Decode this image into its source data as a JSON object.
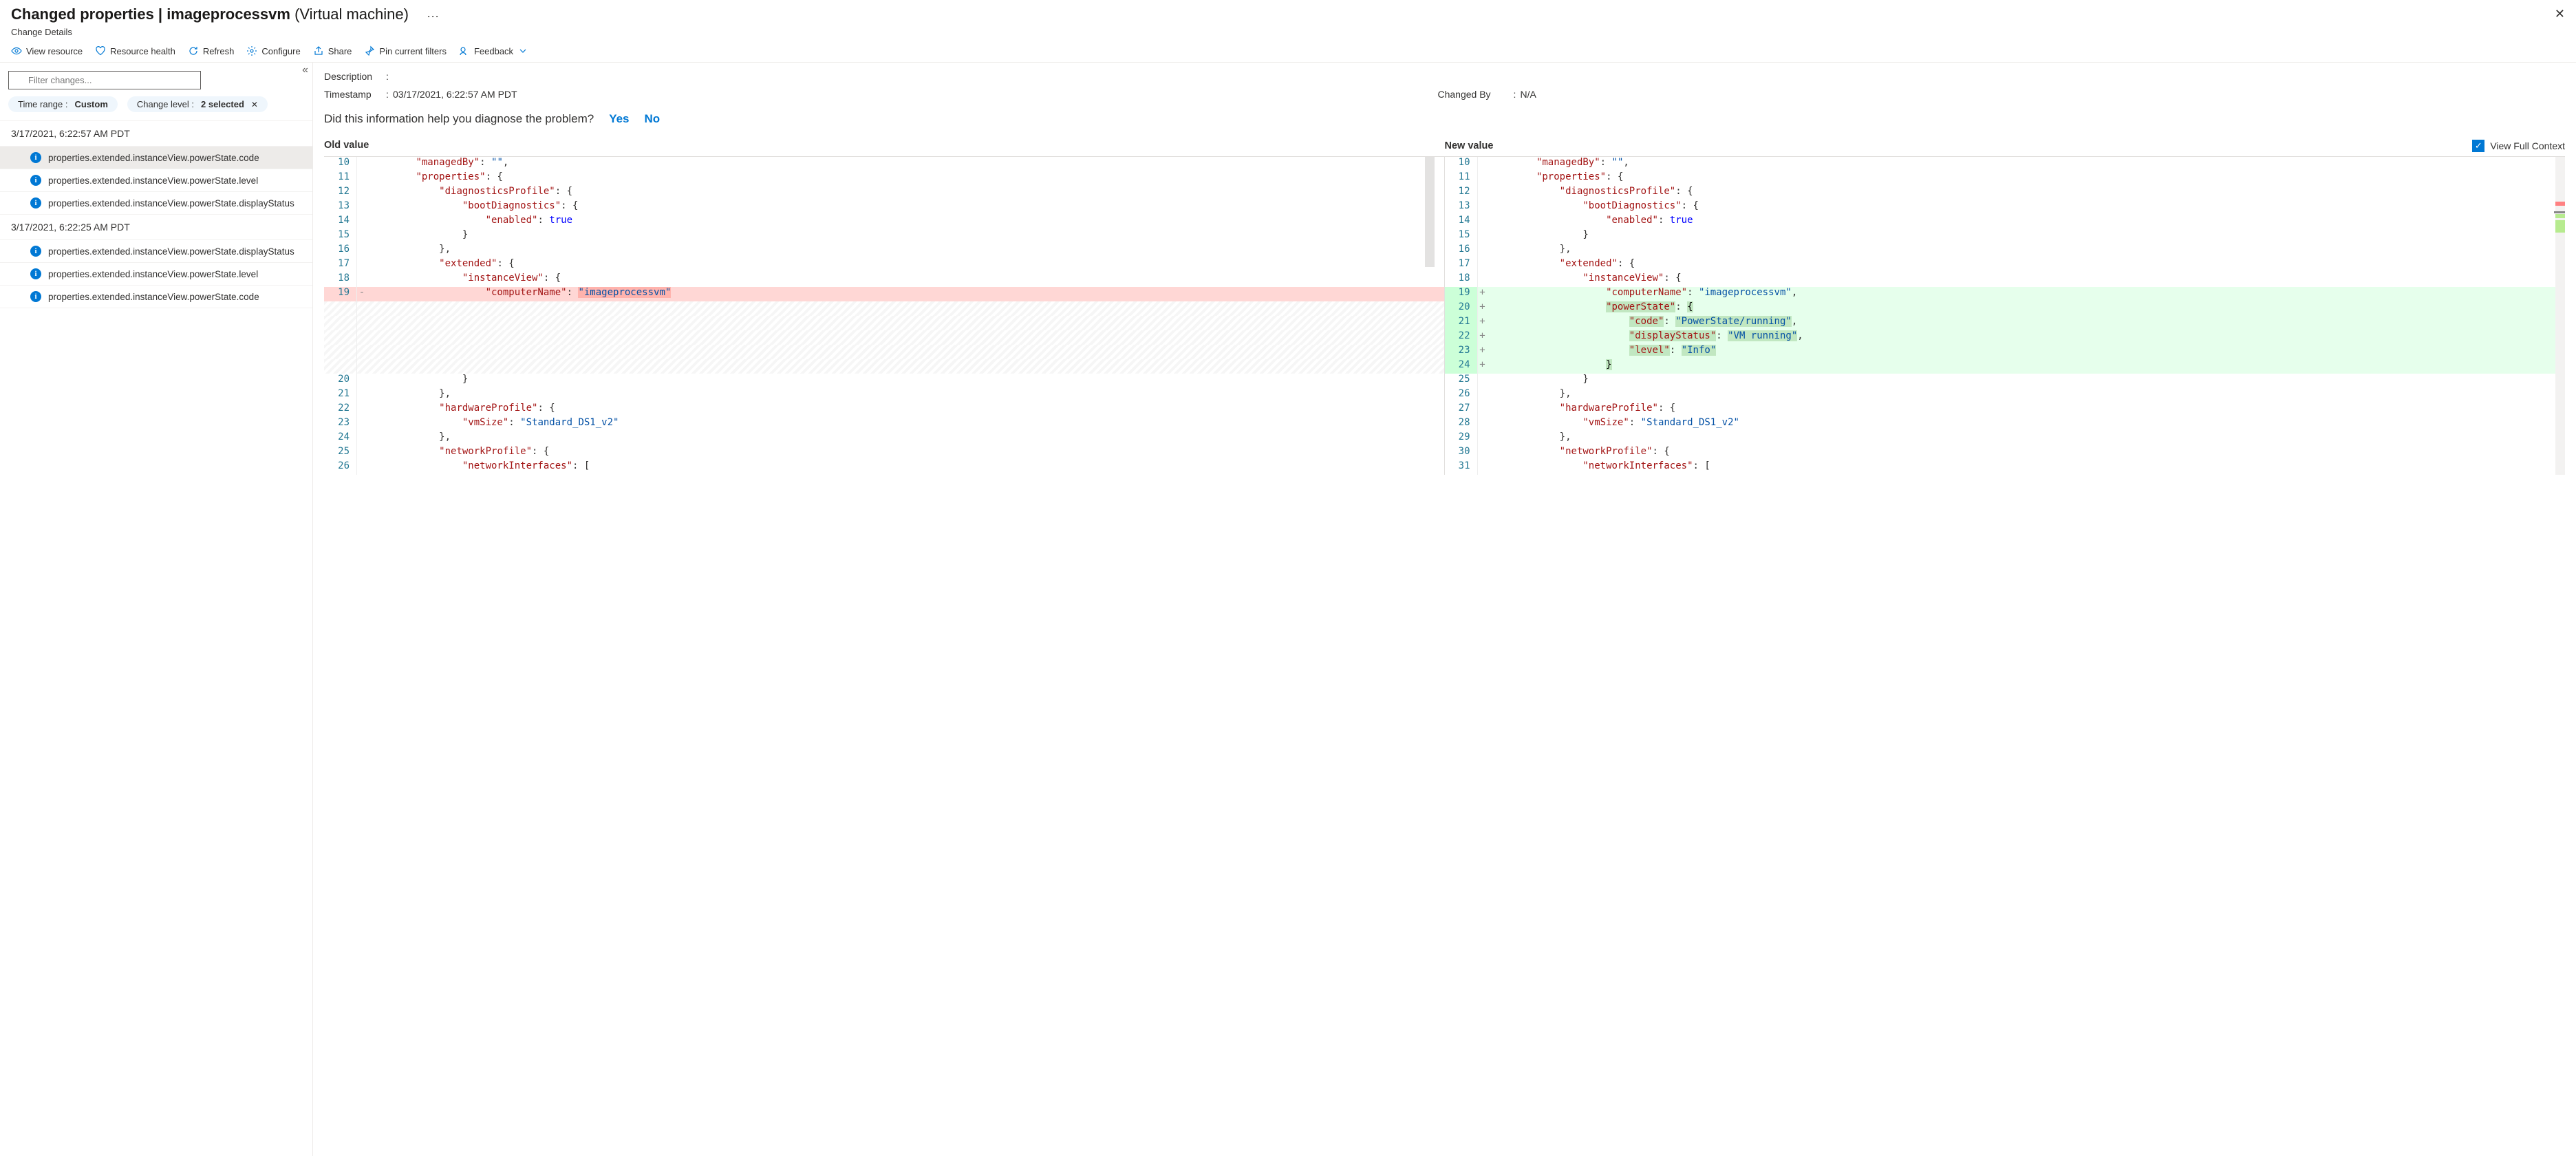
{
  "header": {
    "title_prefix": "Changed properties | ",
    "title_name": "imageprocessvm",
    "title_suffix": " (Virtual machine)",
    "subtitle": "Change Details"
  },
  "toolbar": {
    "view_resource": "View resource",
    "resource_health": "Resource health",
    "refresh": "Refresh",
    "configure": "Configure",
    "share": "Share",
    "pin": "Pin current filters",
    "feedback": "Feedback"
  },
  "left": {
    "filter_placeholder": "Filter changes...",
    "pill_time_label": "Time range : ",
    "pill_time_value": "Custom",
    "pill_level_label": "Change level : ",
    "pill_level_value": "2 selected",
    "groups": [
      {
        "ts": "3/17/2021, 6:22:57 AM PDT",
        "items": [
          "properties.extended.instanceView.powerState.code",
          "properties.extended.instanceView.powerState.level",
          "properties.extended.instanceView.powerState.displayStatus"
        ]
      },
      {
        "ts": "3/17/2021, 6:22:25 AM PDT",
        "items": [
          "properties.extended.instanceView.powerState.displayStatus",
          "properties.extended.instanceView.powerState.level",
          "properties.extended.instanceView.powerState.code"
        ]
      }
    ]
  },
  "meta": {
    "description_label": "Description",
    "description_value": "",
    "timestamp_label": "Timestamp",
    "timestamp_value": "03/17/2021, 6:22:57 AM PDT",
    "changed_by_label": "Changed By",
    "changed_by_value": "N/A"
  },
  "question": {
    "text": "Did this information help you diagnose the problem?",
    "yes": "Yes",
    "no": "No"
  },
  "diff": {
    "old_label": "Old value",
    "new_label": "New value",
    "full_context": "View Full Context",
    "old": [
      {
        "n": 10,
        "tokens": [
          [
            "        ",
            ""
          ],
          [
            "\"managedBy\"",
            "k"
          ],
          [
            ": ",
            ""
          ],
          [
            "\"\"",
            "s"
          ],
          [
            ",",
            ""
          ]
        ]
      },
      {
        "n": 11,
        "tokens": [
          [
            "        ",
            ""
          ],
          [
            "\"properties\"",
            "k"
          ],
          [
            ": {",
            ""
          ]
        ]
      },
      {
        "n": 12,
        "tokens": [
          [
            "            ",
            ""
          ],
          [
            "\"diagnosticsProfile\"",
            "k"
          ],
          [
            ": {",
            ""
          ]
        ]
      },
      {
        "n": 13,
        "tokens": [
          [
            "                ",
            ""
          ],
          [
            "\"bootDiagnostics\"",
            "k"
          ],
          [
            ": {",
            ""
          ]
        ]
      },
      {
        "n": 14,
        "tokens": [
          [
            "                    ",
            ""
          ],
          [
            "\"enabled\"",
            "k"
          ],
          [
            ": ",
            ""
          ],
          [
            "true",
            "b"
          ]
        ]
      },
      {
        "n": 15,
        "tokens": [
          [
            "                }",
            ""
          ]
        ]
      },
      {
        "n": 16,
        "tokens": [
          [
            "            },",
            ""
          ]
        ]
      },
      {
        "n": 17,
        "tokens": [
          [
            "            ",
            ""
          ],
          [
            "\"extended\"",
            "k"
          ],
          [
            ": {",
            ""
          ]
        ]
      },
      {
        "n": 18,
        "tokens": [
          [
            "                ",
            ""
          ],
          [
            "\"instanceView\"",
            "k"
          ],
          [
            ": {",
            ""
          ]
        ]
      },
      {
        "n": 19,
        "mark": "del",
        "tokens": [
          [
            "                    ",
            ""
          ],
          [
            "\"computerName\"",
            "k"
          ],
          [
            ": ",
            ""
          ],
          [
            "\"imageprocessvm\"",
            "s hl-del"
          ]
        ]
      },
      {
        "placeholder": true
      },
      {
        "placeholder": true
      },
      {
        "placeholder": true
      },
      {
        "placeholder": true
      },
      {
        "placeholder": true
      },
      {
        "n": 20,
        "tokens": [
          [
            "                }",
            ""
          ]
        ]
      },
      {
        "n": 21,
        "tokens": [
          [
            "            },",
            ""
          ]
        ]
      },
      {
        "n": 22,
        "tokens": [
          [
            "            ",
            ""
          ],
          [
            "\"hardwareProfile\"",
            "k"
          ],
          [
            ": {",
            ""
          ]
        ]
      },
      {
        "n": 23,
        "tokens": [
          [
            "                ",
            ""
          ],
          [
            "\"vmSize\"",
            "k"
          ],
          [
            ": ",
            ""
          ],
          [
            "\"Standard_DS1_v2\"",
            "s"
          ]
        ]
      },
      {
        "n": 24,
        "tokens": [
          [
            "            },",
            ""
          ]
        ]
      },
      {
        "n": 25,
        "tokens": [
          [
            "            ",
            ""
          ],
          [
            "\"networkProfile\"",
            "k"
          ],
          [
            ": {",
            ""
          ]
        ]
      },
      {
        "n": 26,
        "tokens": [
          [
            "                ",
            ""
          ],
          [
            "\"networkInterfaces\"",
            "k"
          ],
          [
            ": [",
            ""
          ]
        ]
      }
    ],
    "new": [
      {
        "n": 10,
        "tokens": [
          [
            "        ",
            ""
          ],
          [
            "\"managedBy\"",
            "k"
          ],
          [
            ": ",
            ""
          ],
          [
            "\"\"",
            "s"
          ],
          [
            ",",
            ""
          ]
        ]
      },
      {
        "n": 11,
        "tokens": [
          [
            "        ",
            ""
          ],
          [
            "\"properties\"",
            "k"
          ],
          [
            ": {",
            ""
          ]
        ]
      },
      {
        "n": 12,
        "tokens": [
          [
            "            ",
            ""
          ],
          [
            "\"diagnosticsProfile\"",
            "k"
          ],
          [
            ": {",
            ""
          ]
        ]
      },
      {
        "n": 13,
        "tokens": [
          [
            "                ",
            ""
          ],
          [
            "\"bootDiagnostics\"",
            "k"
          ],
          [
            ": {",
            ""
          ]
        ]
      },
      {
        "n": 14,
        "tokens": [
          [
            "                    ",
            ""
          ],
          [
            "\"enabled\"",
            "k"
          ],
          [
            ": ",
            ""
          ],
          [
            "true",
            "b"
          ]
        ]
      },
      {
        "n": 15,
        "tokens": [
          [
            "                }",
            ""
          ]
        ]
      },
      {
        "n": 16,
        "tokens": [
          [
            "            },",
            ""
          ]
        ]
      },
      {
        "n": 17,
        "tokens": [
          [
            "            ",
            ""
          ],
          [
            "\"extended\"",
            "k"
          ],
          [
            ": {",
            ""
          ]
        ]
      },
      {
        "n": 18,
        "tokens": [
          [
            "                ",
            ""
          ],
          [
            "\"instanceView\"",
            "k"
          ],
          [
            ": {",
            ""
          ]
        ]
      },
      {
        "n": 19,
        "mark": "add",
        "tokens": [
          [
            "                    ",
            ""
          ],
          [
            "\"computerName\"",
            "k"
          ],
          [
            ": ",
            ""
          ],
          [
            "\"imageprocessvm\"",
            "s"
          ],
          [
            ",",
            ""
          ]
        ]
      },
      {
        "n": 20,
        "mark": "add",
        "tokens": [
          [
            "                    ",
            ""
          ],
          [
            "\"powerState\"",
            "k hl-s"
          ],
          [
            ": ",
            ""
          ],
          [
            "{",
            "p hl-s"
          ]
        ]
      },
      {
        "n": 21,
        "mark": "add",
        "tokens": [
          [
            "                        ",
            ""
          ],
          [
            "\"code\"",
            "k hl-s"
          ],
          [
            ": ",
            ""
          ],
          [
            "\"PowerState/running\"",
            "s hl-s"
          ],
          [
            ",",
            ""
          ]
        ]
      },
      {
        "n": 22,
        "mark": "add",
        "tokens": [
          [
            "                        ",
            ""
          ],
          [
            "\"displayStatus\"",
            "k hl-s"
          ],
          [
            ": ",
            ""
          ],
          [
            "\"VM running\"",
            "s hl-s"
          ],
          [
            ",",
            ""
          ]
        ]
      },
      {
        "n": 23,
        "mark": "add",
        "tokens": [
          [
            "                        ",
            ""
          ],
          [
            "\"level\"",
            "k hl-s"
          ],
          [
            ": ",
            ""
          ],
          [
            "\"Info\"",
            "s hl-s"
          ]
        ]
      },
      {
        "n": 24,
        "mark": "add",
        "tokens": [
          [
            "                    ",
            ""
          ],
          [
            "}",
            "p hl-s"
          ]
        ]
      },
      {
        "n": 25,
        "tokens": [
          [
            "                }",
            ""
          ]
        ]
      },
      {
        "n": 26,
        "tokens": [
          [
            "            },",
            ""
          ]
        ]
      },
      {
        "n": 27,
        "tokens": [
          [
            "            ",
            ""
          ],
          [
            "\"hardwareProfile\"",
            "k"
          ],
          [
            ": {",
            ""
          ]
        ]
      },
      {
        "n": 28,
        "tokens": [
          [
            "                ",
            ""
          ],
          [
            "\"vmSize\"",
            "k"
          ],
          [
            ": ",
            ""
          ],
          [
            "\"Standard_DS1_v2\"",
            "s"
          ]
        ]
      },
      {
        "n": 29,
        "tokens": [
          [
            "            },",
            ""
          ]
        ]
      },
      {
        "n": 30,
        "tokens": [
          [
            "            ",
            ""
          ],
          [
            "\"networkProfile\"",
            "k"
          ],
          [
            ": {",
            ""
          ]
        ]
      },
      {
        "n": 31,
        "tokens": [
          [
            "                ",
            ""
          ],
          [
            "\"networkInterfaces\"",
            "k"
          ],
          [
            ": [",
            ""
          ]
        ]
      }
    ]
  }
}
